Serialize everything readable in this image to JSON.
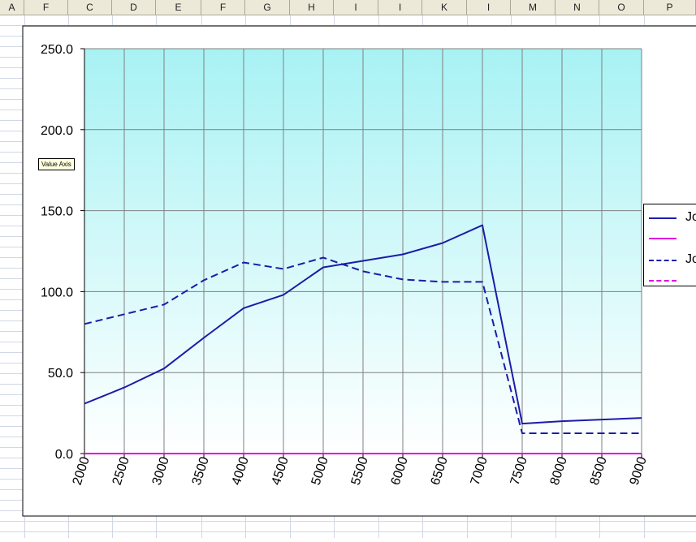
{
  "spreadsheet": {
    "column_headers": [
      "A",
      "F",
      "C",
      "D",
      "E",
      "F",
      "G",
      "H",
      "I",
      "I",
      "K",
      "I",
      "M",
      "N",
      "O",
      "P"
    ]
  },
  "tooltip": "Value Axis",
  "chart_data": {
    "type": "line",
    "x": [
      2000,
      2500,
      3000,
      3500,
      4000,
      4500,
      5000,
      5500,
      6000,
      6500,
      7000,
      7500,
      8000,
      8500,
      9000
    ],
    "xlim": [
      2000,
      9000
    ],
    "ylim": [
      0,
      250
    ],
    "y_ticks": [
      "0.0",
      "50.0",
      "100.0",
      "150.0",
      "200.0",
      "250.0"
    ],
    "x_ticks": [
      "2000",
      "2500",
      "3000",
      "3500",
      "4000",
      "4500",
      "5000",
      "5500",
      "6000",
      "6500",
      "7000",
      "7500",
      "8000",
      "8500",
      "9000"
    ],
    "grid": true,
    "plot_background": {
      "top": "#a8f2f4",
      "bottom": "#ffffff"
    },
    "legend_position": "right",
    "series": [
      {
        "name": "Jo",
        "color": "#1c1ca8",
        "style": "solid",
        "values": [
          30.8,
          40.8,
          52.5,
          71.5,
          89.8,
          98.0,
          115.0,
          119.0,
          123.0,
          130.0,
          141.0,
          18.5,
          20.0,
          21.0,
          22.0
        ]
      },
      {
        "name": "",
        "color": "#dd00dd",
        "style": "solid",
        "values": [
          0,
          0,
          0,
          0,
          0,
          0,
          0,
          0,
          0,
          0,
          0,
          0,
          0,
          0,
          0
        ]
      },
      {
        "name": "Jo",
        "color": "#1c1ca8",
        "style": "dashed",
        "values": [
          80.0,
          86.0,
          92.0,
          107.0,
          118.0,
          114.0,
          121.0,
          112.5,
          107.5,
          106.0,
          106.0,
          12.5,
          12.5,
          12.5,
          12.5
        ]
      },
      {
        "name": "",
        "color": "#dd00dd",
        "style": "dashed",
        "values": [
          0,
          0,
          0,
          0,
          0,
          0,
          0,
          0,
          0,
          0,
          0,
          0,
          0,
          0,
          0
        ]
      }
    ]
  }
}
